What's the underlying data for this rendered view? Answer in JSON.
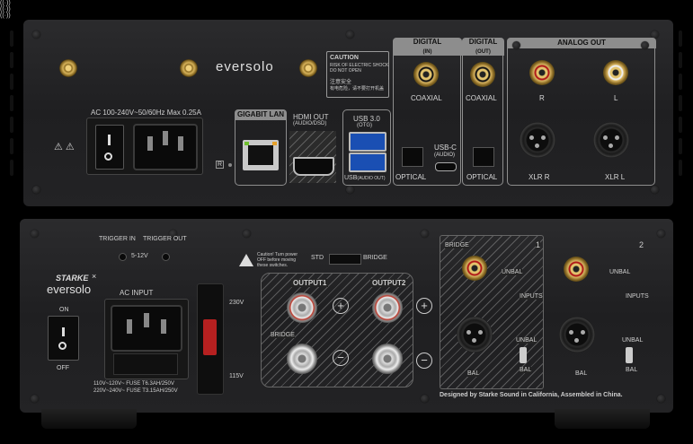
{
  "top_unit": {
    "brand": "eversolo",
    "power": {
      "rating": "AC 100-240V~50/60Hz Max 0.25A",
      "warning_symbols": "⚠ ⚠"
    },
    "caution": {
      "title": "CAUTION",
      "line1": "RISK OF ELECTRIC SHOCK",
      "line2": "DO NOT OPEN",
      "cn_title": "注意安全",
      "cn_line": "有电危险，请不要打开机盖"
    },
    "lan": {
      "label": "GIGABIT LAN"
    },
    "hdmi": {
      "label": "HDMI OUT",
      "sub": "(AUDIO/DSD)"
    },
    "usb3": {
      "label": "USB 3.0",
      "sub": "(OTG)",
      "bottom_label": "USB",
      "bottom_sub": "(AUDIO OUT)"
    },
    "digital_in": {
      "title": "DIGITAL",
      "sub": "(IN)",
      "coaxial": "COAXIAL",
      "optical": "OPTICAL",
      "usbc": "USB-C",
      "usbc_sub": "(AUDIO)"
    },
    "digital_out": {
      "title": "DIGITAL",
      "sub": "(OUT)",
      "coaxial": "COAXIAL",
      "optical": "OPTICAL"
    },
    "analog_out": {
      "title": "ANALOG OUT",
      "r": "R",
      "l": "L",
      "xlr_r": "XLR R",
      "xlr_l": "XLR L"
    },
    "reg_mark": "R"
  },
  "bottom_unit": {
    "trigger_in": "TRIGGER IN",
    "trigger_out": "TRIGGER OUT",
    "trigger_volt": "5-12V",
    "brand_starke": "STARKE",
    "brand_x": "×",
    "brand_eversolo": "eversolo",
    "ac_input": "AC INPUT",
    "power_on": "ON",
    "power_off": "OFF",
    "fuse1": "110V~120V~  FUSE T6.3AH/250V",
    "fuse2": "220V~240V~  FUSE T3.15AH/250V",
    "volt_230": "230V",
    "volt_115": "115V",
    "caution_text": "Caution! Turn power OFF before moving these switches.",
    "std": "STD",
    "bridge_switch": "BRIDGE",
    "output1": "OUTPUT1",
    "output2": "OUTPUT2",
    "bridge_label": "BRIDGE",
    "plus": "+",
    "minus": "−",
    "ch1": {
      "num": "1",
      "bridge": "BRIDGE",
      "unbal": "UNBAL",
      "inputs": "INPUTS",
      "unbal2": "UNBAL",
      "bal": "BAL",
      "bal2": "BAL"
    },
    "ch2": {
      "num": "2",
      "unbal": "UNBAL",
      "inputs": "INPUTS",
      "unbal2": "UNBAL",
      "bal": "BAL",
      "bal2": "BAL"
    },
    "footer": "Designed by Starke Sound in California, Assembled in China."
  }
}
